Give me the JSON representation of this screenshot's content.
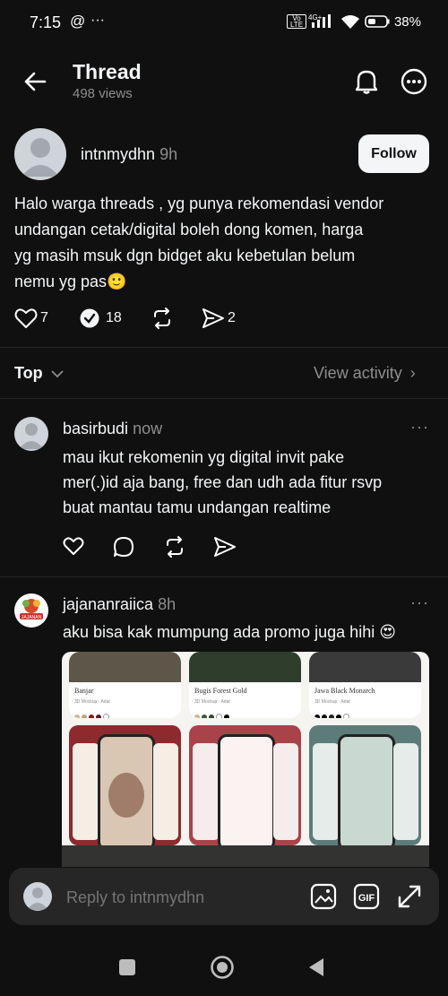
{
  "status": {
    "time": "7:15",
    "battery": "38%"
  },
  "header": {
    "title": "Thread",
    "views": "498 views"
  },
  "post": {
    "username": "intnmydhn",
    "time": "9h",
    "follow_label": "Follow",
    "text_lines": [
      "Halo warga threads , yg punya rekomendasi vendor",
      "undangan cetak/digital boleh dong komen, harga",
      "yg masih msuk dgn bidget aku kebetulan belum",
      "nemu yg pas🙂"
    ],
    "likes": "7",
    "replies": "18",
    "shares": "2"
  },
  "sort": {
    "label": "Top",
    "view_activity": "View activity"
  },
  "comments": [
    {
      "username": "basirbudi",
      "time": "now",
      "lines": [
        "mau ikut rekomenin yg digital invit pake",
        "mer(.)id aja bang, free dan udh ada fitur rsvp",
        "buat mantau tamu undangan realtime"
      ]
    },
    {
      "username": "jajananraiica",
      "time": "8h",
      "lines": [
        "aku bisa kak  mumpung ada promo juga hihi 😍"
      ],
      "cards": [
        {
          "name": "Banjar",
          "sub": "3D Mockup · Adat",
          "colors": [
            "#c9b58a",
            "#b8a37a",
            "#7a1e24",
            "#5b1a20",
            "#ffffff"
          ]
        },
        {
          "name": "Bugis Forest Gold",
          "sub": "3D Mockup · Adat",
          "colors": [
            "#c9b58a",
            "#3c5a3a",
            "#2c4a2c",
            "#ffffff",
            "#000000"
          ]
        },
        {
          "name": "Jawa Black Monarch",
          "sub": "3D Mockup · Adat",
          "colors": [
            "#000000",
            "#111111",
            "#222222",
            "#000000",
            "#ffffff"
          ]
        }
      ],
      "avatar_text": "JAJANAN"
    }
  ],
  "reply": {
    "placeholder": "Reply to intnmydhn"
  }
}
